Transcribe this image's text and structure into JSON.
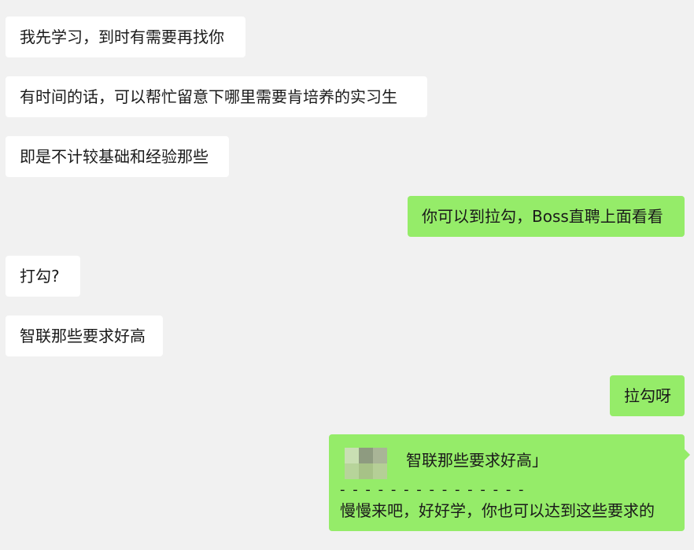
{
  "messages": [
    {
      "side": "left",
      "text": "我先学习，到时有需要再找你"
    },
    {
      "side": "left",
      "text": "有时间的话，可以帮忙留意下哪里需要肯培养的实习生"
    },
    {
      "side": "left",
      "text": "即是不计较基础和经验那些"
    },
    {
      "side": "right",
      "text": "你可以到拉勾，Boss直聘上面看看"
    },
    {
      "side": "left",
      "text": "打勾?"
    },
    {
      "side": "left",
      "text": "智联那些要求好高"
    },
    {
      "side": "right",
      "text": "拉勾呀"
    }
  ],
  "quote_reply": {
    "quoted_text": "智联那些要求好高」",
    "divider": "- - - - - - - - - - - - - - -",
    "reply_text": "慢慢来吧，好好学，你也可以达到这些要求的"
  },
  "colors": {
    "background": "#f1f1f1",
    "incoming_bubble": "#ffffff",
    "outgoing_bubble": "#95ec69"
  }
}
